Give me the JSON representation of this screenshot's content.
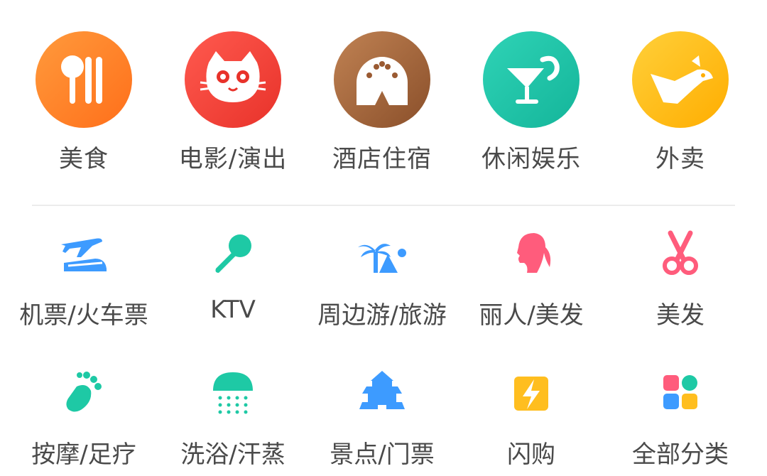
{
  "main_categories": [
    {
      "label": "美食",
      "icon": "food-utensils-icon",
      "color_from": "#ff9a3c",
      "color_to": "#ff6f1a"
    },
    {
      "label": "电影/演出",
      "icon": "cat-face-icon",
      "color_from": "#ff5a4f",
      "color_to": "#e8322a"
    },
    {
      "label": "酒店住宿",
      "icon": "hotel-dome-icon",
      "color_from": "#b8784a",
      "color_to": "#8a4f2a"
    },
    {
      "label": "休闲娱乐",
      "icon": "cocktail-icon",
      "color_from": "#2fd3b6",
      "color_to": "#14b59a"
    },
    {
      "label": "外卖",
      "icon": "delivery-kangaroo-icon",
      "color_from": "#ffcc2a",
      "color_to": "#ffad00"
    }
  ],
  "sub_categories_row1": [
    {
      "label": "机票/火车票",
      "icon": "plane-train-icon"
    },
    {
      "label": "KTV",
      "icon": "microphone-icon"
    },
    {
      "label": "周边游/旅游",
      "icon": "palm-island-icon"
    },
    {
      "label": "丽人/美发",
      "icon": "woman-profile-icon"
    },
    {
      "label": "美发",
      "icon": "scissors-icon"
    }
  ],
  "sub_categories_row2": [
    {
      "label": "按摩/足疗",
      "icon": "footprint-icon"
    },
    {
      "label": "洗浴/汗蒸",
      "icon": "shower-icon"
    },
    {
      "label": "景点/门票",
      "icon": "temple-icon"
    },
    {
      "label": "闪购",
      "icon": "lightning-icon"
    },
    {
      "label": "全部分类",
      "icon": "all-categories-icon"
    }
  ],
  "colors": {
    "text": "#4a4a4a",
    "blue": "#3d9bff",
    "teal": "#1ec9a5",
    "pink": "#ff5c7c",
    "yellow": "#ffbe1f"
  }
}
